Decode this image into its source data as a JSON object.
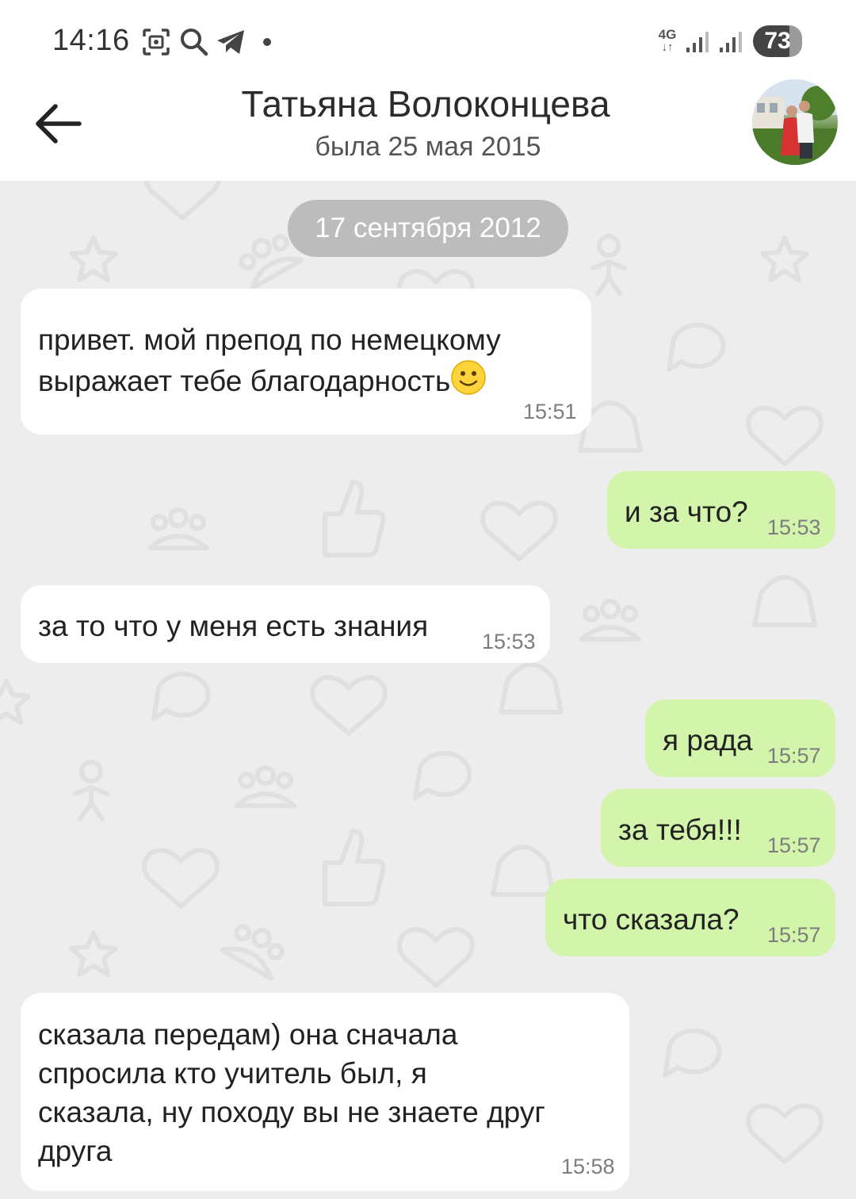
{
  "status_bar": {
    "time": "14:16",
    "network": "4G",
    "battery": "73"
  },
  "header": {
    "contact_name": "Татьяна Волоконцева",
    "last_seen": "была 25 мая 2015"
  },
  "chat": {
    "date_separator": "17 сентября 2012",
    "messages": [
      {
        "direction": "in",
        "lines": [
          "привет. мой препод по немецкому",
          "выражает тебе благодарность"
        ],
        "emoji": "slightly-smiling-face",
        "time": "15:51"
      },
      {
        "direction": "out",
        "lines": [
          "и за что?"
        ],
        "time": "15:53"
      },
      {
        "direction": "in",
        "lines": [
          "за то что у меня есть знания"
        ],
        "time": "15:53"
      },
      {
        "direction": "out",
        "lines": [
          "я рада"
        ],
        "time": "15:57"
      },
      {
        "direction": "out",
        "lines": [
          "за тебя!!!"
        ],
        "time": "15:57"
      },
      {
        "direction": "out",
        "lines": [
          "что сказала?"
        ],
        "time": "15:57"
      },
      {
        "direction": "in",
        "lines": [
          "сказала передам) она сначала",
          "спросила кто учитель был, я",
          "сказала, ну походу вы не знаете друг",
          "друга"
        ],
        "time": "15:58"
      }
    ]
  },
  "colors": {
    "incoming_bubble": "#ffffff",
    "outgoing_bubble": "#d3f5ab",
    "chat_background": "#ededed",
    "date_pill": "#bcbcbc"
  }
}
